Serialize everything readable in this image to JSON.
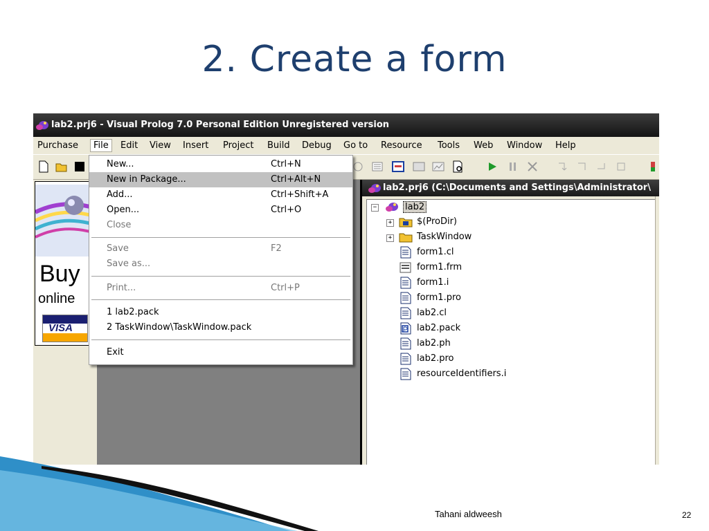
{
  "slide": {
    "title": "2. Create a form",
    "author": "Tahani aldweesh",
    "page_number": "22"
  },
  "window": {
    "title": "lab2.prj6 - Visual Prolog 7.0 Personal Edition Unregistered version"
  },
  "menubar": {
    "items": [
      "Purchase",
      "File",
      "Edit",
      "View",
      "Insert",
      "Project",
      "Build",
      "Debug",
      "Go to",
      "Resource",
      "Tools",
      "Web",
      "Window",
      "Help"
    ],
    "active": "File"
  },
  "file_menu": {
    "items": [
      {
        "label": "New...",
        "shortcut": "Ctrl+N",
        "enabled": true
      },
      {
        "label": "New in Package...",
        "shortcut": "Ctrl+Alt+N",
        "enabled": true,
        "highlighted": true
      },
      {
        "label": "Add...",
        "shortcut": "Ctrl+Shift+A",
        "enabled": true
      },
      {
        "label": "Open...",
        "shortcut": "Ctrl+O",
        "enabled": true
      },
      {
        "label": "Close",
        "shortcut": "",
        "enabled": false
      },
      {
        "label": "Save",
        "shortcut": "F2",
        "enabled": false
      },
      {
        "label": "Save as...",
        "shortcut": "",
        "enabled": false
      },
      {
        "label": "Print...",
        "shortcut": "Ctrl+P",
        "enabled": false
      },
      {
        "label": "1 lab2.pack",
        "shortcut": "",
        "enabled": true
      },
      {
        "label": "2 TaskWindow\\TaskWindow.pack",
        "shortcut": "",
        "enabled": true
      },
      {
        "label": "Exit",
        "shortcut": "",
        "enabled": true
      }
    ]
  },
  "ad_panel": {
    "buy_text": "Buy",
    "online_text": "online",
    "card_text": "VISA"
  },
  "project_window": {
    "title": "lab2.prj6 (C:\\Documents and Settings\\Administrator\\",
    "root": "lab2",
    "folders": [
      "$(ProDir)",
      "TaskWindow"
    ],
    "files": [
      "form1.cl",
      "form1.frm",
      "form1.i",
      "form1.pro",
      "lab2.cl",
      "lab2.pack",
      "lab2.ph",
      "lab2.pro",
      "resourceIdentifiers.i"
    ]
  },
  "colors": {
    "title_text": "#1e3f6e",
    "menu_highlight": "#c1c1c1",
    "window_bg": "#ece9d8",
    "deco_blue": "#2f8fc8"
  }
}
